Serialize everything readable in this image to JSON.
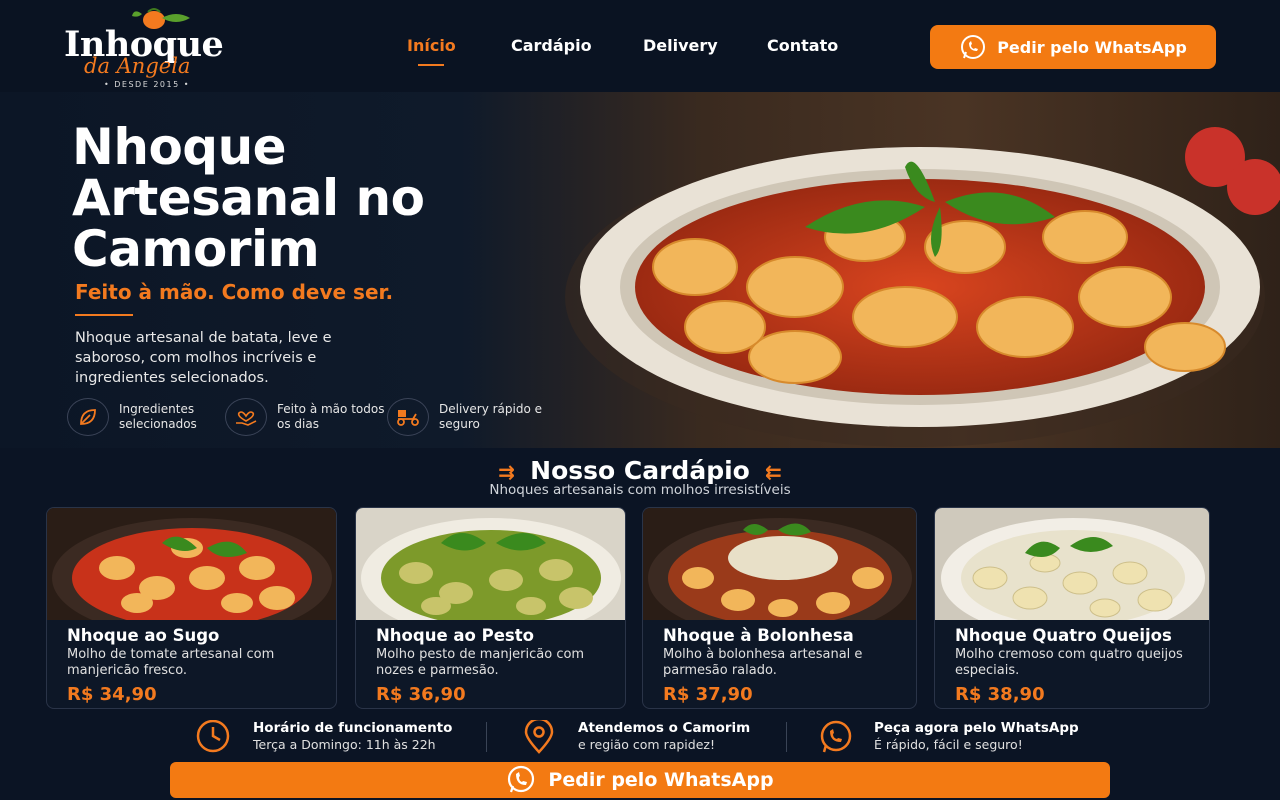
{
  "brand": {
    "name_main": "Inhoque",
    "name_script": "da Angela",
    "since": "• DESDE 2015 •",
    "accent_color": "#f37a1f"
  },
  "nav": {
    "items": [
      {
        "label": "Início",
        "active": true
      },
      {
        "label": "Cardápio",
        "active": false
      },
      {
        "label": "Delivery",
        "active": false
      },
      {
        "label": "Contato",
        "active": false
      }
    ],
    "cta_label": "Pedir pelo WhatsApp",
    "cta_icon": "whatsapp-icon"
  },
  "hero": {
    "title": "Nhoque Artesanal no Camorim",
    "tagline": "Feito à mão. Como deve ser.",
    "description": "Nhoque artesanal de batata, leve e saboroso, com molhos incríveis e ingredientes selecionados.",
    "features": [
      {
        "icon": "leaf-icon",
        "text": "Ingredientes selecionados"
      },
      {
        "icon": "heart-hand-icon",
        "text": "Feito à mão todos os dias"
      },
      {
        "icon": "delivery-scooter-icon",
        "text": "Delivery rápido e seguro"
      }
    ]
  },
  "menu": {
    "title": "Nosso Cardápio",
    "subtitle": "Nhoques artesanais com molhos irresistíveis",
    "items": [
      {
        "name": "Nhoque ao Sugo",
        "description": "Molho de tomate artesanal com manjericão fresco.",
        "price": "R$ 34,90",
        "sauce_color": "#c8321a"
      },
      {
        "name": "Nhoque ao Pesto",
        "description": "Molho pesto de manjericão com nozes e parmesão.",
        "price": "R$ 36,90",
        "sauce_color": "#7d9a2a"
      },
      {
        "name": "Nhoque à Bolonhesa",
        "description": "Molho à bolonhesa artesanal e parmesão ralado.",
        "price": "R$ 37,90",
        "sauce_color": "#9a3a1a"
      },
      {
        "name": "Nhoque Quatro Queijos",
        "description": "Molho cremoso com quatro queijos especiais.",
        "price": "R$ 38,90",
        "sauce_color": "#e8e2cc"
      }
    ]
  },
  "info": [
    {
      "icon": "clock-icon",
      "title": "Horário de funcionamento",
      "subtitle": "Terça a Domingo: 11h às 22h"
    },
    {
      "icon": "location-pin-icon",
      "title": "Atendemos o Camorim",
      "subtitle": "e região com rapidez!"
    },
    {
      "icon": "whatsapp-icon",
      "title": "Peça agora pelo WhatsApp",
      "subtitle": "É rápido, fácil e seguro!"
    }
  ],
  "bottom_cta": {
    "label": "Pedir pelo WhatsApp",
    "icon": "whatsapp-icon"
  }
}
